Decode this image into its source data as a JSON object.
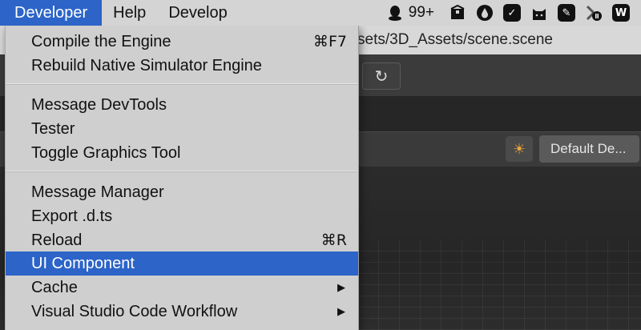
{
  "menubar": {
    "items": [
      "Developer",
      "Help",
      "Develop"
    ],
    "status": {
      "qq_badge": "99+",
      "icons": [
        "qq-icon",
        "package-icon",
        "droplet-icon",
        "checkmark-icon",
        "cat-icon",
        "note-icon",
        "arrow-pause-icon",
        "wps-icon"
      ]
    }
  },
  "editor": {
    "path_text": "sets/3D_Assets/scene.scene",
    "refresh_glyph": "↻",
    "light_glyph": "☀",
    "default_button": "Default De..."
  },
  "dropdown": {
    "items": [
      {
        "label": "Compile the Engine",
        "shortcut": "⌘F7"
      },
      {
        "label": "Rebuild Native Simulator Engine",
        "shortcut": ""
      },
      {
        "label": "Message DevTools",
        "shortcut": ""
      },
      {
        "label": "Tester",
        "shortcut": ""
      },
      {
        "label": "Toggle Graphics Tool",
        "shortcut": ""
      },
      {
        "label": "Message Manager",
        "shortcut": ""
      },
      {
        "label": "Export .d.ts",
        "shortcut": ""
      },
      {
        "label": "Reload",
        "shortcut": "⌘R"
      },
      {
        "label": "UI Component",
        "shortcut": ""
      },
      {
        "label": "Cache",
        "shortcut": ""
      },
      {
        "label": "Visual Studio Code Workflow",
        "shortcut": ""
      }
    ],
    "submenu_arrow": "▶"
  },
  "colors": {
    "accent": "#2c64c8",
    "menu_bg": "#cfcfcf",
    "editor_dark": "#2b2b2b"
  }
}
